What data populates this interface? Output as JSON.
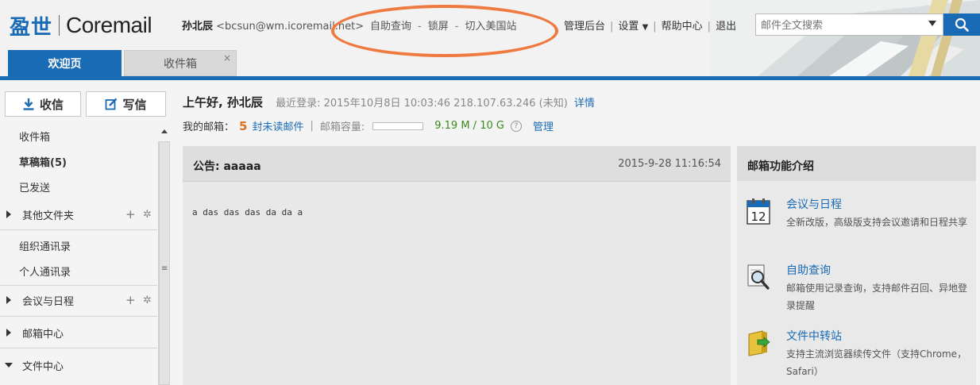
{
  "header": {
    "logo_cn": "盈世",
    "logo_en": "Coremail",
    "user_name": "孙北辰",
    "user_email": "<bcsun@wm.icoremail.net>",
    "self_links": [
      "自助查询",
      "锁屏",
      "切入美国站"
    ],
    "admin": "管理后台",
    "settings": "设置",
    "help": "帮助中心",
    "logout": "退出",
    "search_placeholder": "邮件全文搜索"
  },
  "tabs": [
    {
      "label": "欢迎页",
      "active": true
    },
    {
      "label": "收件箱",
      "active": false,
      "close": "×"
    }
  ],
  "sidebar": {
    "receive": "收信",
    "write": "写信",
    "folders": [
      "收件箱",
      "草稿箱(5)",
      "已发送"
    ],
    "other_folders": "其他文件夹",
    "contacts": [
      "组织通讯录",
      "个人通讯录"
    ],
    "calendar": "会议与日程",
    "mail_center": "邮箱中心",
    "file_center": "文件中心"
  },
  "welcome": {
    "greeting": "上午好, 孙北辰",
    "last_login": "最近登录: 2015年10月8日 10:03:46 218.107.63.246 (未知)",
    "detail": "详情",
    "my_mailbox": "我的邮箱：",
    "unread_count": "5",
    "unread_label": "封未读邮件",
    "capacity_label": "邮箱容量:",
    "capacity_used": "9.19 M / 10 G",
    "capacity_fraction": 0.0009,
    "manage": "管理"
  },
  "notice": {
    "title": "公告: aaaaa",
    "date": "2015-9-28 11:16:54",
    "body": "a das das das da da a"
  },
  "features": {
    "title": "邮箱功能介绍",
    "items": [
      {
        "icon": "calendar-icon",
        "title": "会议与日程",
        "desc": "全新改版，高级版支持会议邀请和日程共享",
        "calendar_day": "12"
      },
      {
        "icon": "magnifier-icon",
        "title": "自助查询",
        "desc": "邮箱使用记录查询，支持邮件召回、异地登录提醒"
      },
      {
        "icon": "file-transfer-icon",
        "title": "文件中转站",
        "desc": "支持主流浏览器续传文件（支持Chrome，Safari）"
      }
    ]
  },
  "colors": {
    "brand_blue": "#1a6bb5",
    "highlight_orange": "#ef7a3f",
    "unread_orange": "#e07020",
    "quota_green": "#3a8a1e"
  }
}
